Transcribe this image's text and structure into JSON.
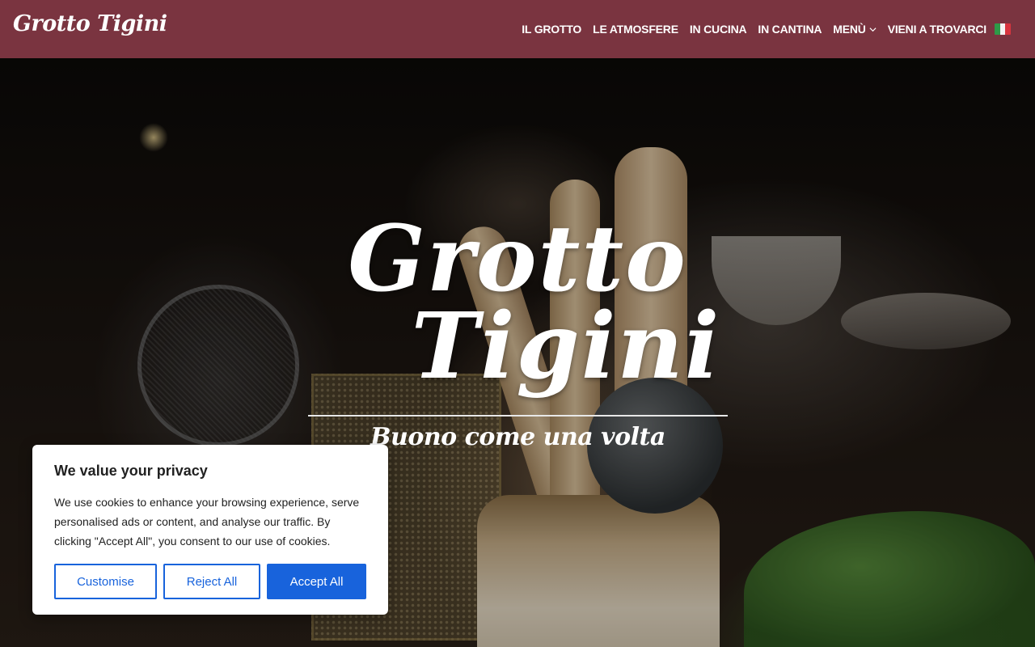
{
  "header": {
    "logo_text": "Grotto Tigini",
    "nav": [
      "IL GROTTO",
      "LE ATMOSFERE",
      "IN CUCINA",
      "IN CANTINA",
      "MENÙ",
      "VIENI A TROVARCI"
    ],
    "language_flag": "italian-flag-icon",
    "colors": {
      "background": "#7a3440",
      "text": "#ffffff"
    }
  },
  "hero": {
    "title_line1": "Grotto",
    "title_line2": "Tigini",
    "subtitle": "Buono come una volta"
  },
  "cookie_banner": {
    "title": "We value your privacy",
    "text": "We use cookies to enhance your browsing experience, serve personalised ads or content, and analyse our traffic. By clicking \"Accept All\", you consent to our use of cookies.",
    "buttons": {
      "customise": "Customise",
      "reject": "Reject All",
      "accept": "Accept All"
    },
    "colors": {
      "accent": "#1863dc"
    }
  }
}
